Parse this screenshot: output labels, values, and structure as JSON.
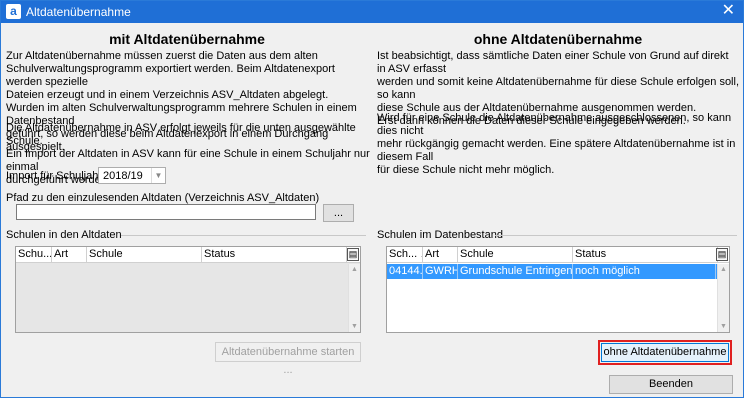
{
  "window": {
    "title": "Altdatenübernahme",
    "app_icon": "a",
    "close_glyph": "✕"
  },
  "left": {
    "heading": "mit Altdatenübernahme",
    "paragraph1": "Zur Altdatenübernahme müssen zuerst die Daten aus dem alten\nSchulverwaltungsprogramm exportiert werden. Beim Altdatenexport werden spezielle\nDateien erzeugt und in einem Verzeichnis ASV_Altdaten abgelegt.\nWurden im alten Schulverwaltungsprogramm mehrere Schulen in einem Datenbestand\ngeführt, so werden diese beim Altdatenexport in einem Durchgang ausgespielt.",
    "paragraph2": "Die Altdatenübernahme in ASV erfolgt jeweils für die unten ausgewählte Schule.\nEin Import der Altdaten in ASV kann für eine Schule in einem Schuljahr nur einmal\ndurchgeführt werden.",
    "schoolyear_label": "Import für Schuljahr",
    "schoolyear_value": "2018/19",
    "path_label": "Pfad zu den einzulesenden Altdaten (Verzeichnis ASV_Altdaten)",
    "path_value": "",
    "browse_label": "...",
    "group_label": "Schulen in den Altdaten",
    "columns": [
      "Schu...",
      "Art",
      "Schule",
      "Status"
    ],
    "start_button": "Altdatenübernahme starten ..."
  },
  "right": {
    "heading": "ohne Altdatenübernahme",
    "paragraph1": "Ist beabsichtigt, dass sämtliche Daten einer Schule von Grund auf direkt in ASV erfasst\nwerden und somit keine Altdatenübernahme für diese Schule erfolgen soll, so kann\ndiese Schule aus der Altdatenübernahme ausgenommen werden.\nErst dann können die Daten dieser Schule eingegeben werden.",
    "paragraph2": "Wird für eine Schule die Altdatenübernahme ausgeschlossenen, so kann dies nicht\nmehr rückgängig gemacht werden. Eine spätere Altdatenübernahme ist in diesem Fall\nfür diese Schule nicht mehr möglich.",
    "group_label": "Schulen im Datenbestand",
    "columns": [
      "Sch...",
      "Art",
      "Schule",
      "Status"
    ],
    "rows": [
      {
        "nr": "04144...",
        "art": "GWRHS",
        "schule": "Grundschule Entringen",
        "status": "noch möglich"
      }
    ],
    "without_button": "ohne Altdatenübernahme",
    "end_button": "Beenden"
  },
  "icons": {
    "sort": "▲",
    "column_chooser": "column-chooser-icon",
    "scroll_up": "▲",
    "scroll_down": "▼",
    "dropdown": "▼"
  },
  "colors": {
    "titlebar": "#1f6fd6",
    "selection": "#3399ff",
    "highlight": "#e02020"
  }
}
